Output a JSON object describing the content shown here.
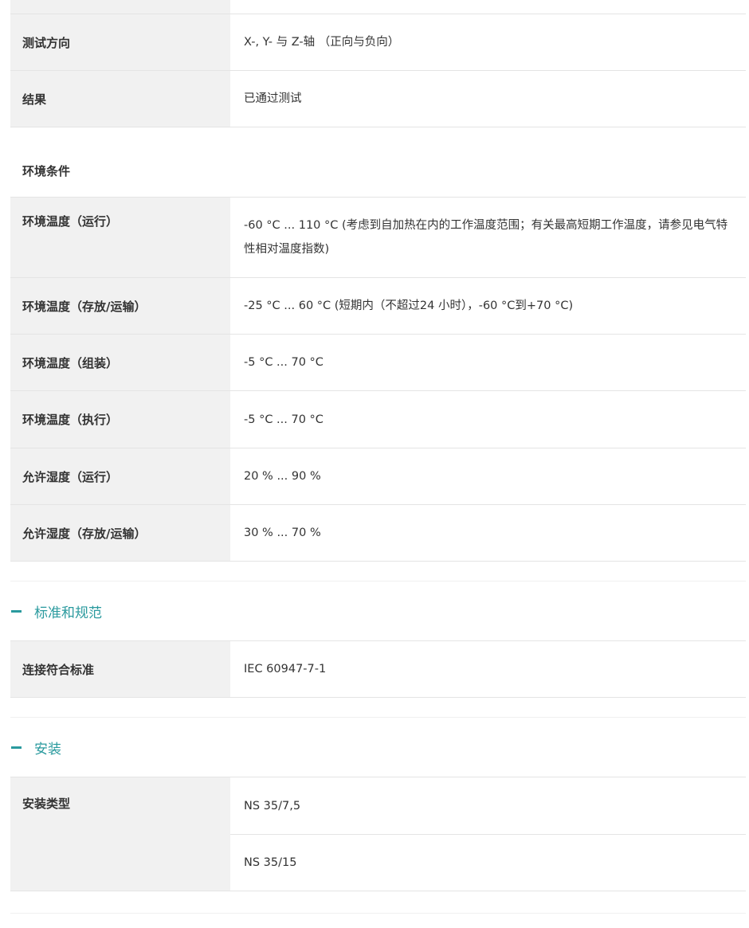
{
  "vibration_rows": [
    {
      "label": "测试方向",
      "value": "X-, Y- 与 Z-轴 （正向与负向）"
    },
    {
      "label": "结果",
      "value": "已通过测试"
    }
  ],
  "environment": {
    "title": "环境条件",
    "rows": [
      {
        "label": "环境温度（运行）",
        "value": "-60 °C ... 110 °C (考虑到自加热在内的工作温度范围；有关最高短期工作温度，请参见电气特性相对温度指数)"
      },
      {
        "label": "环境温度（存放/运输）",
        "value": "-25 °C ... 60 °C (短期内（不超过24  小时），-60 °C到+70 °C)"
      },
      {
        "label": "环境温度（组装）",
        "value": "-5 °C ... 70 °C"
      },
      {
        "label": "环境温度（执行）",
        "value": "-5 °C ... 70 °C"
      },
      {
        "label": "允许湿度（运行）",
        "value": "20 % ... 90 %"
      },
      {
        "label": "允许湿度（存放/运输）",
        "value": "30 % ... 70 %"
      }
    ]
  },
  "standards": {
    "title": "标准和规范",
    "rows": [
      {
        "label": "连接符合标准",
        "value": "IEC 60947-7-1"
      }
    ]
  },
  "mounting": {
    "title": "安装",
    "label": "安装类型",
    "values": [
      "NS 35/7,5",
      "NS 35/15"
    ]
  },
  "colors": {
    "accent": "#2a9a9e",
    "label_bg": "#f1f1f1",
    "border": "#e4e4e4"
  }
}
